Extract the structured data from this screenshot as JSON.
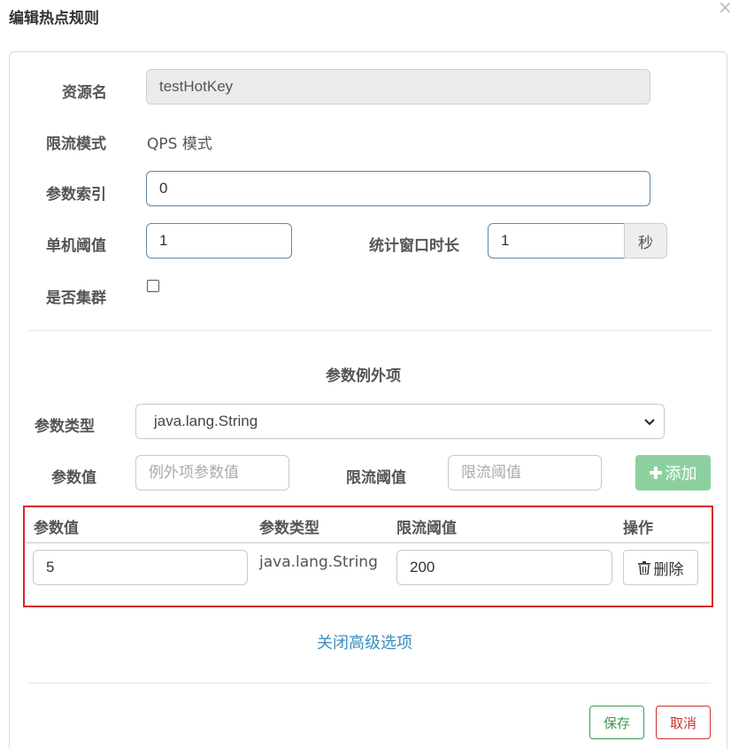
{
  "dialog": {
    "title": "编辑热点规则",
    "close_label": "×"
  },
  "form": {
    "resource_name": {
      "label": "资源名",
      "value": "testHotKey"
    },
    "limit_mode": {
      "label": "限流模式",
      "value": "QPS 模式"
    },
    "param_index": {
      "label": "参数索引",
      "value": "0"
    },
    "single_threshold": {
      "label": "单机阈值",
      "value": "1"
    },
    "stat_window": {
      "label": "统计窗口时长",
      "value": "1",
      "unit": "秒"
    },
    "cluster": {
      "label": "是否集群",
      "checked": false
    }
  },
  "exceptions": {
    "section_title": "参数例外项",
    "param_type": {
      "label": "参数类型",
      "selected": "java.lang.String"
    },
    "param_value": {
      "label": "参数值",
      "placeholder": "例外项参数值"
    },
    "limit_threshold": {
      "label": "限流阈值",
      "placeholder": "限流阈值"
    },
    "add_button": {
      "icon": "plus-icon",
      "label": "添加",
      "color": "#8dd0a0"
    }
  },
  "table": {
    "headers": [
      "参数值",
      "参数类型",
      "限流阈值",
      "操作"
    ],
    "rows": [
      {
        "value": "5",
        "type": "java.lang.String",
        "threshold": "200",
        "action_label": "删除",
        "action_icon": "trash-icon"
      }
    ],
    "highlight_color": "#d9232e"
  },
  "advanced_link": "关闭高级选项",
  "footer": {
    "save_label": "保存",
    "cancel_label": "取消"
  }
}
